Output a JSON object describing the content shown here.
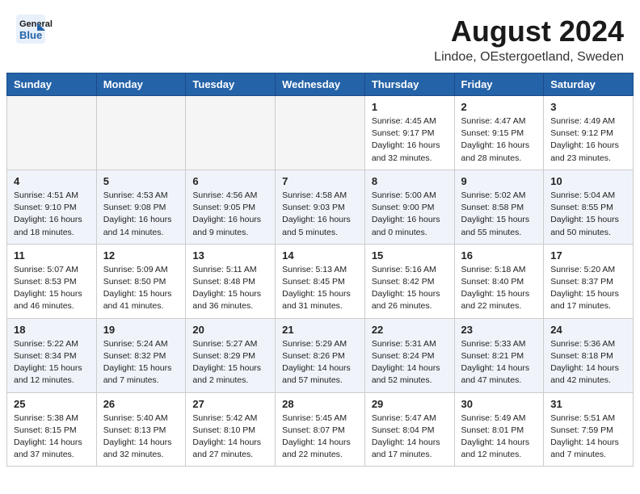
{
  "header": {
    "logo_line1": "General",
    "logo_line2": "Blue",
    "month_year": "August 2024",
    "location": "Lindoe, OEstergoetland, Sweden"
  },
  "weekdays": [
    "Sunday",
    "Monday",
    "Tuesday",
    "Wednesday",
    "Thursday",
    "Friday",
    "Saturday"
  ],
  "weeks": [
    [
      {
        "day": "",
        "info": ""
      },
      {
        "day": "",
        "info": ""
      },
      {
        "day": "",
        "info": ""
      },
      {
        "day": "",
        "info": ""
      },
      {
        "day": "1",
        "info": "Sunrise: 4:45 AM\nSunset: 9:17 PM\nDaylight: 16 hours\nand 32 minutes."
      },
      {
        "day": "2",
        "info": "Sunrise: 4:47 AM\nSunset: 9:15 PM\nDaylight: 16 hours\nand 28 minutes."
      },
      {
        "day": "3",
        "info": "Sunrise: 4:49 AM\nSunset: 9:12 PM\nDaylight: 16 hours\nand 23 minutes."
      }
    ],
    [
      {
        "day": "4",
        "info": "Sunrise: 4:51 AM\nSunset: 9:10 PM\nDaylight: 16 hours\nand 18 minutes."
      },
      {
        "day": "5",
        "info": "Sunrise: 4:53 AM\nSunset: 9:08 PM\nDaylight: 16 hours\nand 14 minutes."
      },
      {
        "day": "6",
        "info": "Sunrise: 4:56 AM\nSunset: 9:05 PM\nDaylight: 16 hours\nand 9 minutes."
      },
      {
        "day": "7",
        "info": "Sunrise: 4:58 AM\nSunset: 9:03 PM\nDaylight: 16 hours\nand 5 minutes."
      },
      {
        "day": "8",
        "info": "Sunrise: 5:00 AM\nSunset: 9:00 PM\nDaylight: 16 hours\nand 0 minutes."
      },
      {
        "day": "9",
        "info": "Sunrise: 5:02 AM\nSunset: 8:58 PM\nDaylight: 15 hours\nand 55 minutes."
      },
      {
        "day": "10",
        "info": "Sunrise: 5:04 AM\nSunset: 8:55 PM\nDaylight: 15 hours\nand 50 minutes."
      }
    ],
    [
      {
        "day": "11",
        "info": "Sunrise: 5:07 AM\nSunset: 8:53 PM\nDaylight: 15 hours\nand 46 minutes."
      },
      {
        "day": "12",
        "info": "Sunrise: 5:09 AM\nSunset: 8:50 PM\nDaylight: 15 hours\nand 41 minutes."
      },
      {
        "day": "13",
        "info": "Sunrise: 5:11 AM\nSunset: 8:48 PM\nDaylight: 15 hours\nand 36 minutes."
      },
      {
        "day": "14",
        "info": "Sunrise: 5:13 AM\nSunset: 8:45 PM\nDaylight: 15 hours\nand 31 minutes."
      },
      {
        "day": "15",
        "info": "Sunrise: 5:16 AM\nSunset: 8:42 PM\nDaylight: 15 hours\nand 26 minutes."
      },
      {
        "day": "16",
        "info": "Sunrise: 5:18 AM\nSunset: 8:40 PM\nDaylight: 15 hours\nand 22 minutes."
      },
      {
        "day": "17",
        "info": "Sunrise: 5:20 AM\nSunset: 8:37 PM\nDaylight: 15 hours\nand 17 minutes."
      }
    ],
    [
      {
        "day": "18",
        "info": "Sunrise: 5:22 AM\nSunset: 8:34 PM\nDaylight: 15 hours\nand 12 minutes."
      },
      {
        "day": "19",
        "info": "Sunrise: 5:24 AM\nSunset: 8:32 PM\nDaylight: 15 hours\nand 7 minutes."
      },
      {
        "day": "20",
        "info": "Sunrise: 5:27 AM\nSunset: 8:29 PM\nDaylight: 15 hours\nand 2 minutes."
      },
      {
        "day": "21",
        "info": "Sunrise: 5:29 AM\nSunset: 8:26 PM\nDaylight: 14 hours\nand 57 minutes."
      },
      {
        "day": "22",
        "info": "Sunrise: 5:31 AM\nSunset: 8:24 PM\nDaylight: 14 hours\nand 52 minutes."
      },
      {
        "day": "23",
        "info": "Sunrise: 5:33 AM\nSunset: 8:21 PM\nDaylight: 14 hours\nand 47 minutes."
      },
      {
        "day": "24",
        "info": "Sunrise: 5:36 AM\nSunset: 8:18 PM\nDaylight: 14 hours\nand 42 minutes."
      }
    ],
    [
      {
        "day": "25",
        "info": "Sunrise: 5:38 AM\nSunset: 8:15 PM\nDaylight: 14 hours\nand 37 minutes."
      },
      {
        "day": "26",
        "info": "Sunrise: 5:40 AM\nSunset: 8:13 PM\nDaylight: 14 hours\nand 32 minutes."
      },
      {
        "day": "27",
        "info": "Sunrise: 5:42 AM\nSunset: 8:10 PM\nDaylight: 14 hours\nand 27 minutes."
      },
      {
        "day": "28",
        "info": "Sunrise: 5:45 AM\nSunset: 8:07 PM\nDaylight: 14 hours\nand 22 minutes."
      },
      {
        "day": "29",
        "info": "Sunrise: 5:47 AM\nSunset: 8:04 PM\nDaylight: 14 hours\nand 17 minutes."
      },
      {
        "day": "30",
        "info": "Sunrise: 5:49 AM\nSunset: 8:01 PM\nDaylight: 14 hours\nand 12 minutes."
      },
      {
        "day": "31",
        "info": "Sunrise: 5:51 AM\nSunset: 7:59 PM\nDaylight: 14 hours\nand 7 minutes."
      }
    ]
  ]
}
